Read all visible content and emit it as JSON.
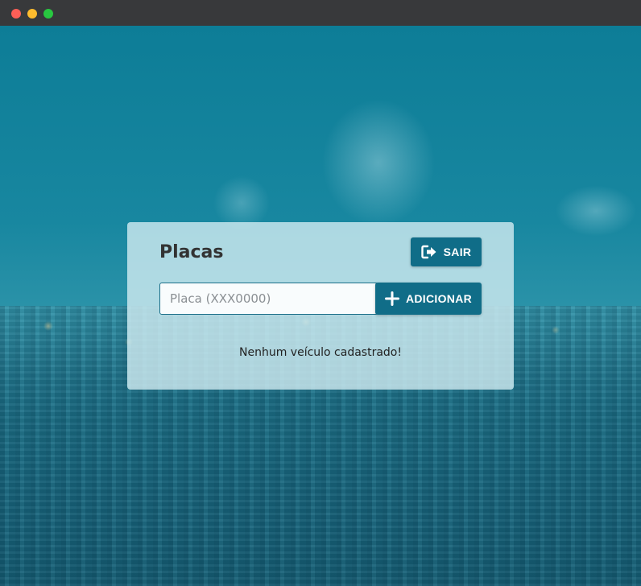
{
  "window": {
    "controls": [
      "close",
      "minimize",
      "maximize"
    ]
  },
  "colors": {
    "accent": "#106d88",
    "card_background": "#ceeaf0",
    "titlebar": "#38393b"
  },
  "card": {
    "title": "Placas",
    "logout_button": {
      "label": "SAIR",
      "icon": "sign-out-icon"
    },
    "plate_input": {
      "value": "",
      "placeholder": "Placa (XXX0000)"
    },
    "add_button": {
      "label": "ADICIONAR",
      "icon": "plus-icon"
    },
    "empty_message": "Nenhum veículo cadastrado!"
  }
}
